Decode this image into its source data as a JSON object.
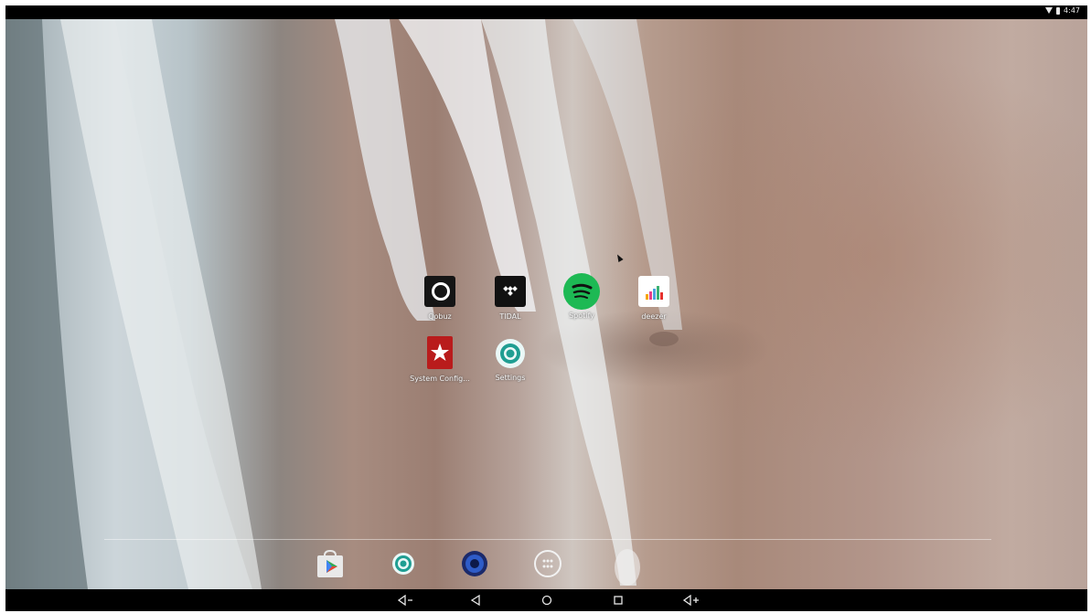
{
  "status_bar": {
    "time": "4:47"
  },
  "home": {
    "apps": [
      {
        "label": "Qobuz",
        "icon": "qobuz-icon"
      },
      {
        "label": "TIDAL",
        "icon": "tidal-icon"
      },
      {
        "label": "Spotify",
        "icon": "spotify-icon"
      },
      {
        "label": "deezer",
        "icon": "deezer-icon"
      },
      {
        "label": "System Config...",
        "icon": "system-config-icon"
      },
      {
        "label": "Settings",
        "icon": "settings-icon"
      }
    ]
  },
  "dock": {
    "items": [
      {
        "icon": "play-store-icon"
      },
      {
        "icon": "settings-icon"
      },
      {
        "icon": "speaker-icon"
      },
      {
        "icon": "app-drawer-icon"
      }
    ]
  },
  "nav_bar": {
    "buttons": [
      {
        "icon": "volume-down-icon"
      },
      {
        "icon": "back-icon"
      },
      {
        "icon": "home-icon"
      },
      {
        "icon": "recents-icon"
      },
      {
        "icon": "volume-up-icon"
      }
    ]
  },
  "colors": {
    "spotify": "#1db954",
    "system_config": "#b91c1c",
    "bar": "#000000"
  }
}
